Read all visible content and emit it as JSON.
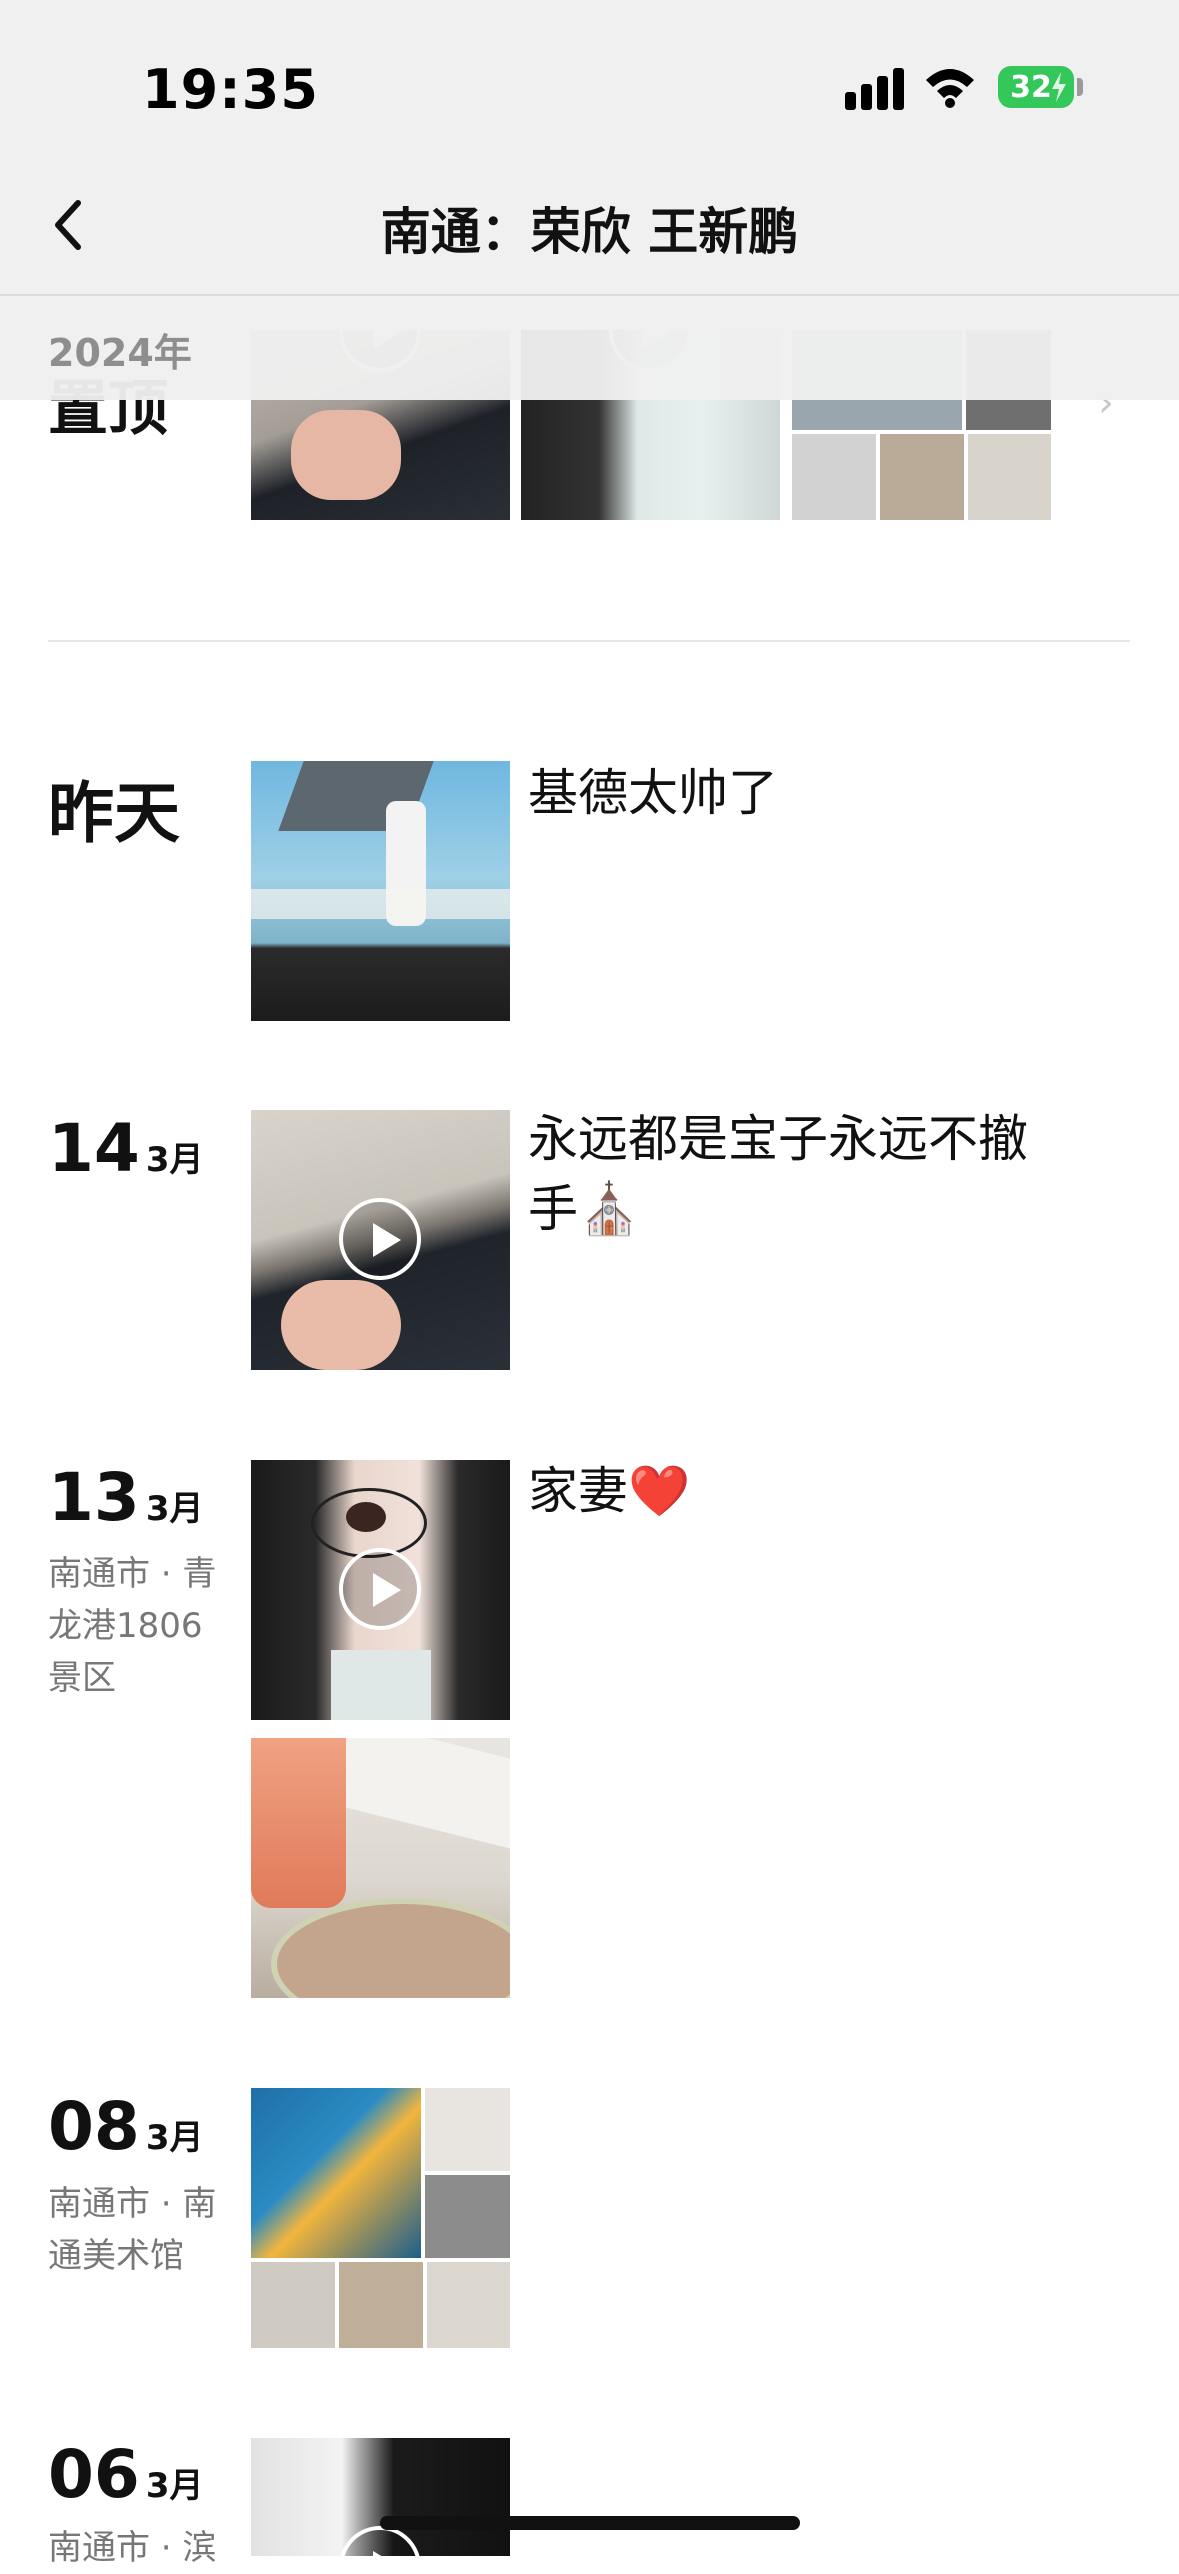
{
  "status_bar": {
    "time": "19:35",
    "battery": "32"
  },
  "nav": {
    "title": "南通：荣欣 王新鹏"
  },
  "year_header": "2024年",
  "clipped_entry": {
    "label": "置顶"
  },
  "entries": [
    {
      "date_big": "昨天",
      "text": "基德太帅了"
    },
    {
      "day": "14",
      "month": "3月",
      "text": "永远都是宝子永远不撤手⛪"
    },
    {
      "day": "13",
      "month": "3月",
      "location": "南通市 · 青龙港1806景区",
      "text": "家妻❤️"
    },
    {
      "day": "08",
      "month": "3月",
      "location": "南通市 · 南通美术馆"
    },
    {
      "day": "06",
      "month": "3月",
      "location": "南通市 · 滨"
    }
  ],
  "colors": {
    "accent_green": "#34c759",
    "secondary_text": "#777777"
  },
  "icons": [
    "back-chevron-icon",
    "signal-icon",
    "wifi-icon",
    "battery-icon",
    "play-icon"
  ]
}
